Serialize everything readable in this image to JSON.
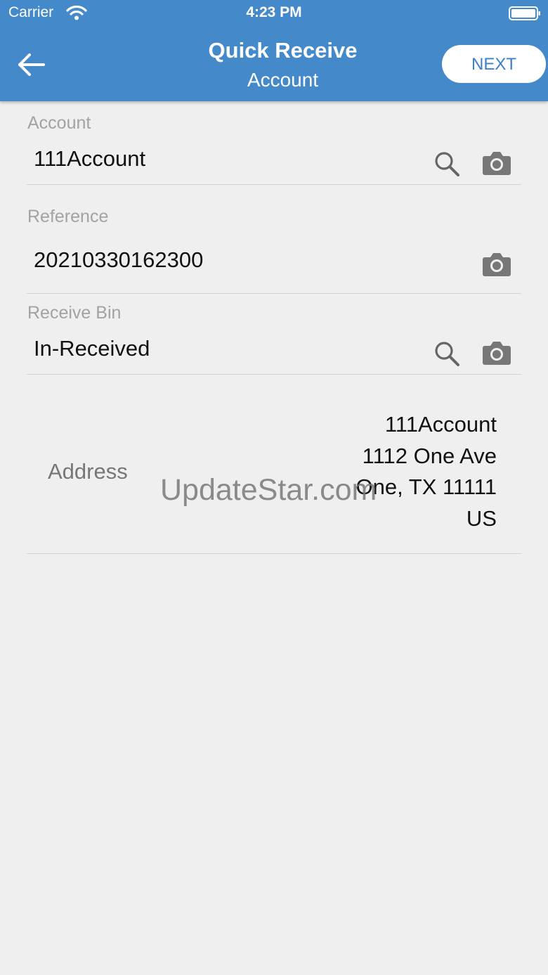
{
  "status_bar": {
    "carrier": "Carrier",
    "time": "4:23 PM"
  },
  "header": {
    "title": "Quick Receive",
    "subtitle": "Account",
    "next_label": "NEXT",
    "background_color": "#4489c9",
    "back_icon": "arrow-left-icon"
  },
  "form": {
    "account": {
      "label": "Account",
      "value": "111Account"
    },
    "reference": {
      "label": "Reference",
      "value": "20210330162300"
    },
    "receive_bin": {
      "label": "Receive Bin",
      "value": "In-Received"
    },
    "address": {
      "label": "Address",
      "lines": [
        "111Account",
        "1112 One Ave",
        "One, TX 11111",
        "US"
      ]
    }
  },
  "watermark": "UpdateStar.com"
}
